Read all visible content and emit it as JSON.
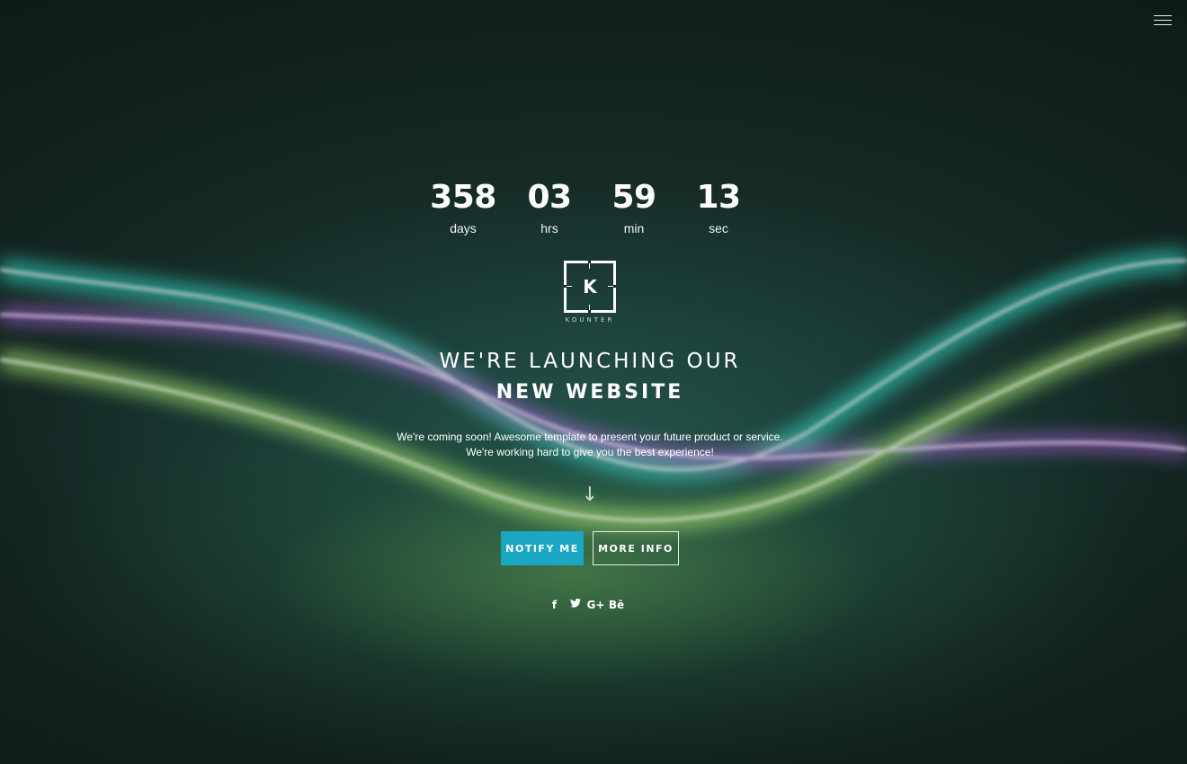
{
  "countdown": {
    "days": {
      "value": "358",
      "label": "days"
    },
    "hours": {
      "value": "03",
      "label": "hrs"
    },
    "minutes": {
      "value": "59",
      "label": "min"
    },
    "seconds": {
      "value": "13",
      "label": "sec"
    }
  },
  "logo": {
    "letter": "K",
    "wordmark": "KOUNTER"
  },
  "headline": {
    "line1": "WE'RE LAUNCHING OUR",
    "line2": "NEW WEBSITE"
  },
  "intro": {
    "line1": "We're coming soon! Awesome template to present your future product or service.",
    "line2": "We're working hard to give you the best experience!"
  },
  "scroll_arrow": "↓",
  "buttons": {
    "notify": "NOTIFY ME",
    "more_info": "MORE INFO"
  },
  "socials": [
    {
      "icon": "facebook-icon",
      "glyph": "f"
    },
    {
      "icon": "twitter-icon",
      "glyph": ""
    },
    {
      "icon": "google-plus-icon",
      "glyph": "G+"
    },
    {
      "icon": "behance-icon",
      "glyph": "Bē"
    }
  ],
  "colors": {
    "accent": "#1aa7c4",
    "text": "#ffffff",
    "background": "#0c1512"
  }
}
